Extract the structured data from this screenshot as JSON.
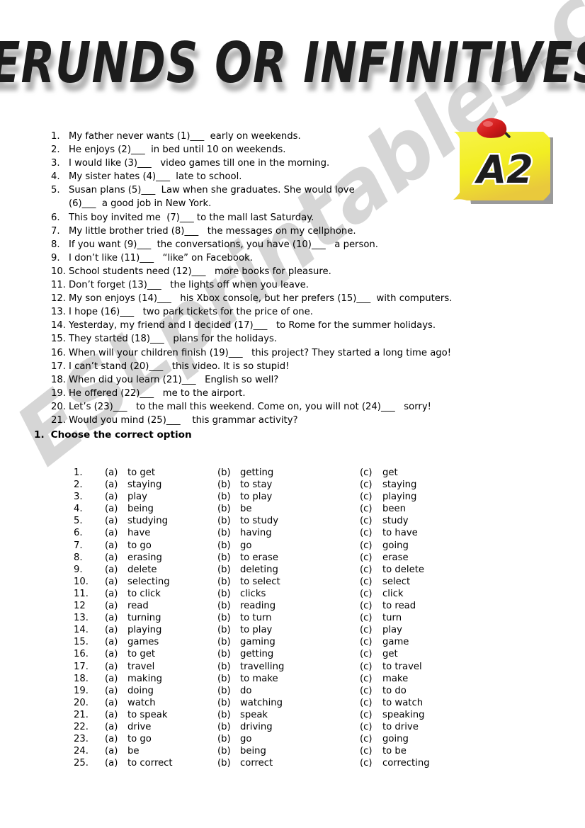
{
  "title": "GERUNDS OR INFINITIVES?",
  "level_badge": {
    "label": "A2",
    "note_color": "#f2ee22",
    "pin_color": "#d21f1f"
  },
  "watermark": {
    "text": "ESLprintables.com",
    "color": "#c9c9c9"
  },
  "sentences": [
    {
      "num": "1.",
      "text": "My father never wants (1)___  early on weekends."
    },
    {
      "num": "2.",
      "text": "He enjoys (2)___  in bed until 10 on weekends."
    },
    {
      "num": "3.",
      "text": "I would like (3)___   video games till one in the morning."
    },
    {
      "num": "4.",
      "text": "My sister hates (4)___  late to school."
    },
    {
      "num": "5.",
      "text": "Susan plans (5)___  Law when she graduates. She would love\n(6)___  a good job in New York."
    },
    {
      "num": "6.",
      "text": "This boy invited me  (7)___ to the mall last Saturday."
    },
    {
      "num": "7.",
      "text": "My little brother tried (8)___   the messages on my cellphone."
    },
    {
      "num": "8.",
      "text": "If you want (9)___  the conversations, you have (10)___   a person."
    },
    {
      "num": "9.",
      "text": "I don’t like (11)___   “like” on Facebook."
    },
    {
      "num": "10.",
      "text": "School students need (12)___   more books for pleasure."
    },
    {
      "num": "11.",
      "text": "Don’t forget (13)___   the lights off when you leave."
    },
    {
      "num": "12.",
      "text": "My son enjoys (14)___   his Xbox console, but her prefers (15)___  with computers."
    },
    {
      "num": "13.",
      "text": "I hope (16)___   two park tickets for the price of one."
    },
    {
      "num": "14.",
      "text": "Yesterday, my friend and I decided (17)___   to Rome for the summer holidays."
    },
    {
      "num": "15.",
      "text": "They started (18)___   plans for the holidays."
    },
    {
      "num": "16.",
      "text": "When will your children finish (19)___   this project? They started a long time ago!"
    },
    {
      "num": "17.",
      "text": "I can’t stand (20)___   this video. It is so stupid!"
    },
    {
      "num": "18.",
      "text": "When did you learn (21)___   English so well?"
    },
    {
      "num": "19.",
      "text": "He offered (22)___   me to the airport."
    },
    {
      "num": "20.",
      "text": "Let’s (23)___   to the mall this weekend. Come on, you will not (24)___   sorry!"
    },
    {
      "num": "21.",
      "text": "Would you mind (25)___    this grammar activity?"
    }
  ],
  "exercise": {
    "number": "1.",
    "heading": "Choose the correct option"
  },
  "option_keys": {
    "a": "(a)",
    "b": "(b)",
    "c": "(c)"
  },
  "options": [
    {
      "num": "1.",
      "a": "to get",
      "b": "getting",
      "c": "get"
    },
    {
      "num": "2.",
      "a": "staying",
      "b": "to stay",
      "c": "staying"
    },
    {
      "num": "3.",
      "a": "play",
      "b": "to play",
      "c": "playing"
    },
    {
      "num": "4.",
      "a": "being",
      "b": "be",
      "c": "been"
    },
    {
      "num": "5.",
      "a": "studying",
      "b": "to study",
      "c": "study"
    },
    {
      "num": "6.",
      "a": "have",
      "b": "having",
      "c": "to have"
    },
    {
      "num": "7.",
      "a": "to go",
      "b": "go",
      "c": "going"
    },
    {
      "num": "8.",
      "a": "erasing",
      "b": "to erase",
      "c": "erase"
    },
    {
      "num": "9.",
      "a": "delete",
      "b": "deleting",
      "c": "to delete"
    },
    {
      "num": "10.",
      "a": "selecting",
      "b": "to select",
      "c": "select"
    },
    {
      "num": "11.",
      "a": "to click",
      "b": "clicks",
      "c": "click"
    },
    {
      "num": "12",
      "a": "read",
      "b": "reading",
      "c": "to read"
    },
    {
      "num": "13.",
      "a": "turning",
      "b": "to turn",
      "c": "turn"
    },
    {
      "num": "14.",
      "a": "playing",
      "b": "to play",
      "c": "play"
    },
    {
      "num": "15.",
      "a": "games",
      "b": "gaming",
      "c": "game"
    },
    {
      "num": "16.",
      "a": "to get",
      "b": "getting",
      "c": "get"
    },
    {
      "num": "17.",
      "a": "travel",
      "b": "travelling",
      "c": "to travel"
    },
    {
      "num": "18.",
      "a": "making",
      "b": "to make",
      "c": "make"
    },
    {
      "num": "19.",
      "a": "doing",
      "b": "do",
      "c": "to do"
    },
    {
      "num": "20.",
      "a": "watch",
      "b": "watching",
      "c": "to watch"
    },
    {
      "num": "21.",
      "a": "to speak",
      "b": "speak",
      "c": "speaking"
    },
    {
      "num": "22.",
      "a": "drive",
      "b": "driving",
      "c": "to drive"
    },
    {
      "num": "23.",
      "a": "to go",
      "b": "go",
      "c": "going"
    },
    {
      "num": "24.",
      "a": "be",
      "b": "being",
      "c": "to be"
    },
    {
      "num": "25.",
      "a": "to correct",
      "b": "correct",
      "c": "correcting"
    }
  ]
}
